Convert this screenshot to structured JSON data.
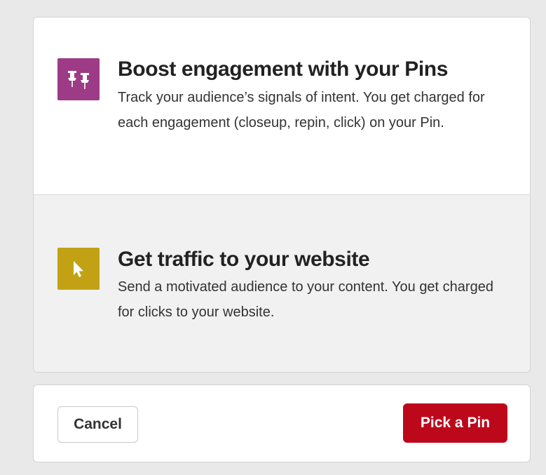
{
  "options": [
    {
      "icon": "pushpin-icon",
      "icon_color": "#9d3b86",
      "title": "Boost engagement with your Pins",
      "description": "Track your audience’s signals of intent. You get charged for each engagement (closeup, repin, click) on your Pin."
    },
    {
      "icon": "cursor-arrow-icon",
      "icon_color": "#c2a214",
      "title": "Get traffic to your website",
      "description": "Send a motivated audience to your content. You get charged for clicks to your website."
    }
  ],
  "footer": {
    "cancel_label": "Cancel",
    "primary_label": "Pick a Pin",
    "primary_color": "#bd081c"
  }
}
